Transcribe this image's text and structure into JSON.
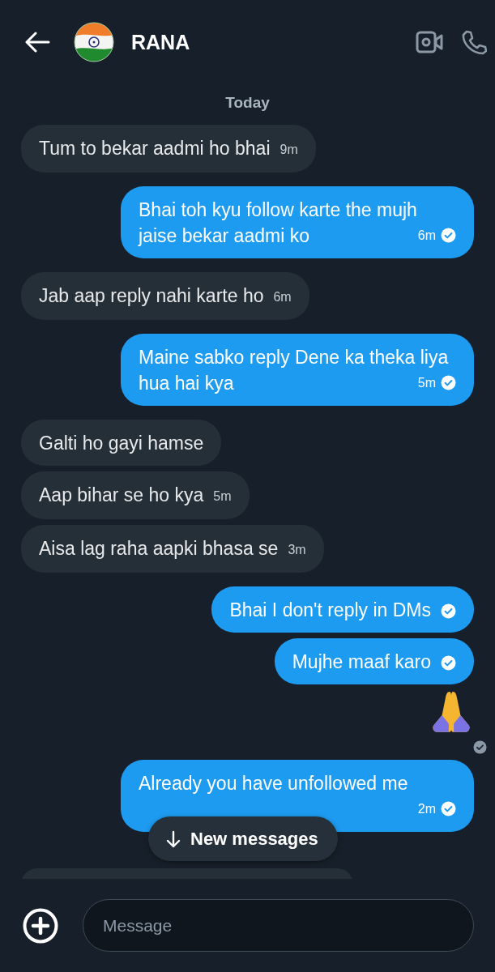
{
  "header": {
    "name": "RANA"
  },
  "date_label": "Today",
  "messages": [
    {
      "kind": "text",
      "outgoing": false,
      "text": "Tum to bekar aadmi ho bhai",
      "time": "9m"
    },
    {
      "kind": "text",
      "outgoing": true,
      "text": "Bhai toh kyu follow karte the mujh jaise bekar aadmi ko",
      "time": "6m",
      "read": true
    },
    {
      "kind": "text",
      "outgoing": false,
      "text": "Jab aap reply nahi karte ho",
      "time": "6m"
    },
    {
      "kind": "text",
      "outgoing": true,
      "text": "Maine sabko reply Dene ka theka liya hua hai kya",
      "time": "5m",
      "read": true
    },
    {
      "kind": "text",
      "outgoing": false,
      "text": "Galti ho gayi hamse"
    },
    {
      "kind": "text",
      "outgoing": false,
      "text": "Aap bihar se ho kya",
      "time": "5m"
    },
    {
      "kind": "text",
      "outgoing": false,
      "text": "Aisa lag raha aapki bhasa se",
      "time": "3m"
    },
    {
      "kind": "text",
      "outgoing": true,
      "text": "Bhai I don't reply in DMs",
      "read": true
    },
    {
      "kind": "text",
      "outgoing": true,
      "text": "Mujhe maaf karo",
      "read": true
    },
    {
      "kind": "praying_hands",
      "outgoing": true,
      "read": false
    },
    {
      "kind": "text",
      "outgoing": true,
      "text": "Already you have unfollowed me",
      "time": "2m",
      "read": true
    },
    {
      "kind": "partial",
      "outgoing": false
    }
  ],
  "new_messages_button": {
    "label": "New messages"
  },
  "composer": {
    "placeholder": "Message"
  }
}
